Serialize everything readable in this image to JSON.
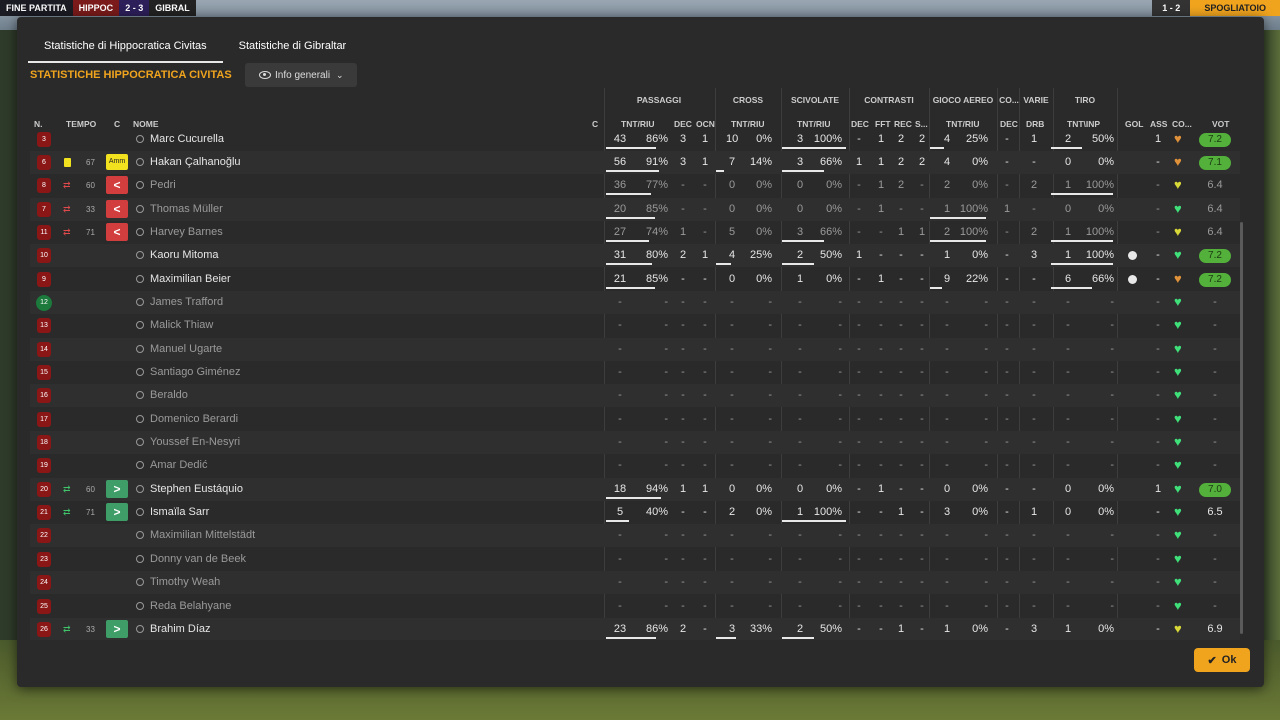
{
  "topbar": {
    "end_label": "FINE PARTITA",
    "home": "HIPPOC",
    "score": "2 - 3",
    "away": "GIBRAL",
    "time": "1 - 2",
    "dress_label": "SPOGLIATOIO"
  },
  "tabs": [
    {
      "label": "Statistiche di Hippocratica Civitas",
      "active": true
    },
    {
      "label": "Statistiche di Gibraltar",
      "active": false
    }
  ],
  "section_title": "STATISTICHE HIPPOCRATICA CIVITAS",
  "view_dropdown": {
    "label": "Info generali"
  },
  "groups": [
    "PASSAGGI",
    "CROSS",
    "SCIVOLATE",
    "CONTRASTI",
    "GIOCO AEREO",
    "CO...",
    "VARIE",
    "TIRO"
  ],
  "headers": {
    "n": "N.",
    "tempo": "TEMPO",
    "c": "C",
    "nome": "NOME",
    "c2": "C",
    "pass_tnt": "TNT/RIU",
    "pass_dec": "DEC",
    "pass_ocn": "OCN",
    "cross_tnt": "TNT/RIU",
    "sciv_tnt": "TNT/RIU",
    "con_dec": "DEC",
    "con_fft": "FFT",
    "con_rec": "REC",
    "con_s": "S...",
    "aereo_tnt": "TNT/RIU",
    "co_dec": "DEC",
    "drb": "DRB",
    "tiro_tnt": "TNT\\INP",
    "gol": "GOL",
    "ass": "ASS",
    "cond": "CO...",
    "vot": "VOT"
  },
  "players": [
    {
      "num": "3",
      "name": "Marc Cucurella",
      "active": true,
      "min": "",
      "sub": "",
      "card": "",
      "pass": [
        "43",
        "86%"
      ],
      "pass_dec": "3",
      "pass_ocn": "1",
      "cross": [
        "10",
        "0%"
      ],
      "sciv": [
        "3",
        "100%"
      ],
      "con": [
        "-",
        "1",
        "2",
        "2"
      ],
      "aereo": [
        "4",
        "25%"
      ],
      "co_dec": "-",
      "drb": "1",
      "tiro": [
        "2",
        "50%"
      ],
      "gol": "",
      "ass": "1",
      "cond": "orange",
      "vote": "7.2",
      "vote_hl": true,
      "pass_f": 0.86,
      "cross_f": 0,
      "sciv_f": 1.0,
      "aereo_f": 0.25,
      "tiro_f": 0.5
    },
    {
      "num": "6",
      "name": "Hakan Çalhanoğlu",
      "active": true,
      "min": "67",
      "sub": "",
      "card": "Amm",
      "pass": [
        "56",
        "91%"
      ],
      "pass_dec": "3",
      "pass_ocn": "1",
      "cross": [
        "7",
        "14%"
      ],
      "sciv": [
        "3",
        "66%"
      ],
      "con": [
        "1",
        "1",
        "2",
        "2"
      ],
      "aereo": [
        "4",
        "0%"
      ],
      "co_dec": "-",
      "drb": "-",
      "tiro": [
        "0",
        "0%"
      ],
      "gol": "",
      "ass": "-",
      "cond": "orange",
      "vote": "7.1",
      "vote_hl": true,
      "pass_f": 0.91,
      "cross_f": 0.14,
      "sciv_f": 0.66,
      "aereo_f": 0,
      "tiro_f": 0
    },
    {
      "num": "8",
      "name": "Pedri",
      "active": false,
      "min": "60",
      "sub": "out",
      "card": "",
      "pass": [
        "36",
        "77%"
      ],
      "pass_dec": "-",
      "pass_ocn": "-",
      "cross": [
        "0",
        "0%"
      ],
      "sciv": [
        "0",
        "0%"
      ],
      "con": [
        "-",
        "1",
        "2",
        "-"
      ],
      "aereo": [
        "2",
        "0%"
      ],
      "co_dec": "-",
      "drb": "2",
      "tiro": [
        "1",
        "100%"
      ],
      "gol": "",
      "ass": "-",
      "cond": "yellow",
      "vote": "6.4",
      "vote_hl": false,
      "pass_f": 0.77,
      "cross_f": 0,
      "sciv_f": 0,
      "aereo_f": 0,
      "tiro_f": 1.0
    },
    {
      "num": "7",
      "name": "Thomas Müller",
      "active": false,
      "min": "33",
      "sub": "out",
      "card": "",
      "pass": [
        "20",
        "85%"
      ],
      "pass_dec": "-",
      "pass_ocn": "-",
      "cross": [
        "0",
        "0%"
      ],
      "sciv": [
        "0",
        "0%"
      ],
      "con": [
        "-",
        "1",
        "-",
        "-"
      ],
      "aereo": [
        "1",
        "100%"
      ],
      "co_dec": "1",
      "drb": "-",
      "tiro": [
        "0",
        "0%"
      ],
      "gol": "",
      "ass": "-",
      "cond": "green",
      "vote": "6.4",
      "vote_hl": false,
      "pass_f": 0.85,
      "cross_f": 0,
      "sciv_f": 0,
      "aereo_f": 1.0,
      "tiro_f": 0
    },
    {
      "num": "11",
      "name": "Harvey Barnes",
      "active": false,
      "min": "71",
      "sub": "out",
      "card": "",
      "pass": [
        "27",
        "74%"
      ],
      "pass_dec": "1",
      "pass_ocn": "-",
      "cross": [
        "5",
        "0%"
      ],
      "sciv": [
        "3",
        "66%"
      ],
      "con": [
        "-",
        "-",
        "1",
        "1"
      ],
      "aereo": [
        "2",
        "100%"
      ],
      "co_dec": "-",
      "drb": "2",
      "tiro": [
        "1",
        "100%"
      ],
      "gol": "",
      "ass": "-",
      "cond": "yellow",
      "vote": "6.4",
      "vote_hl": false,
      "pass_f": 0.74,
      "cross_f": 0,
      "sciv_f": 0.66,
      "aereo_f": 1.0,
      "tiro_f": 1.0
    },
    {
      "num": "10",
      "name": "Kaoru Mitoma",
      "active": true,
      "min": "",
      "sub": "",
      "card": "",
      "pass": [
        "31",
        "80%"
      ],
      "pass_dec": "2",
      "pass_ocn": "1",
      "cross": [
        "4",
        "25%"
      ],
      "sciv": [
        "2",
        "50%"
      ],
      "con": [
        "1",
        "-",
        "-",
        "-"
      ],
      "aereo": [
        "1",
        "0%"
      ],
      "co_dec": "-",
      "drb": "3",
      "tiro": [
        "1",
        "100%"
      ],
      "gol": "ball",
      "ass": "-",
      "cond": "green",
      "vote": "7.2",
      "vote_hl": true,
      "pass_f": 0.8,
      "cross_f": 0.25,
      "sciv_f": 0.5,
      "aereo_f": 0,
      "tiro_f": 1.0
    },
    {
      "num": "9",
      "name": "Maximilian Beier",
      "active": true,
      "min": "",
      "sub": "",
      "card": "",
      "pass": [
        "21",
        "85%"
      ],
      "pass_dec": "-",
      "pass_ocn": "-",
      "cross": [
        "0",
        "0%"
      ],
      "sciv": [
        "1",
        "0%"
      ],
      "con": [
        "-",
        "1",
        "-",
        "-"
      ],
      "aereo": [
        "9",
        "22%"
      ],
      "co_dec": "-",
      "drb": "-",
      "tiro": [
        "6",
        "66%"
      ],
      "gol": "ball",
      "ass": "-",
      "cond": "orange",
      "vote": "7.2",
      "vote_hl": true,
      "pass_f": 0.85,
      "cross_f": 0,
      "sciv_f": 0,
      "aereo_f": 0.22,
      "tiro_f": 0.66
    },
    {
      "num": "12",
      "name": "James Trafford",
      "active": false,
      "gk": true,
      "empty": true
    },
    {
      "num": "13",
      "name": "Malick Thiaw",
      "active": false,
      "empty": true
    },
    {
      "num": "14",
      "name": "Manuel Ugarte",
      "active": false,
      "empty": true
    },
    {
      "num": "15",
      "name": "Santiago Giménez",
      "active": false,
      "empty": true
    },
    {
      "num": "16",
      "name": "Beraldo",
      "active": false,
      "empty": true
    },
    {
      "num": "17",
      "name": "Domenico Berardi",
      "active": false,
      "empty": true
    },
    {
      "num": "18",
      "name": "Youssef En-Nesyri",
      "active": false,
      "empty": true
    },
    {
      "num": "19",
      "name": "Amar Dedić",
      "active": false,
      "empty": true
    },
    {
      "num": "20",
      "name": "Stephen Eustáquio",
      "active": true,
      "min": "60",
      "sub": "in",
      "card": "",
      "pass": [
        "18",
        "94%"
      ],
      "pass_dec": "1",
      "pass_ocn": "1",
      "cross": [
        "0",
        "0%"
      ],
      "sciv": [
        "0",
        "0%"
      ],
      "con": [
        "-",
        "1",
        "-",
        "-"
      ],
      "aereo": [
        "0",
        "0%"
      ],
      "co_dec": "-",
      "drb": "-",
      "tiro": [
        "0",
        "0%"
      ],
      "gol": "",
      "ass": "1",
      "cond": "green",
      "vote": "7.0",
      "vote_hl": true,
      "pass_f": 0.94,
      "cross_f": 0,
      "sciv_f": 0,
      "aereo_f": 0,
      "tiro_f": 0
    },
    {
      "num": "21",
      "name": "Ismaïla Sarr",
      "active": true,
      "min": "71",
      "sub": "in",
      "card": "",
      "pass": [
        "5",
        "40%"
      ],
      "pass_dec": "-",
      "pass_ocn": "-",
      "cross": [
        "2",
        "0%"
      ],
      "sciv": [
        "1",
        "100%"
      ],
      "con": [
        "-",
        "-",
        "1",
        "-"
      ],
      "aereo": [
        "3",
        "0%"
      ],
      "co_dec": "-",
      "drb": "1",
      "tiro": [
        "0",
        "0%"
      ],
      "gol": "",
      "ass": "-",
      "cond": "green",
      "vote": "6.5",
      "vote_hl": false,
      "pass_f": 0.4,
      "cross_f": 0,
      "sciv_f": 1.0,
      "aereo_f": 0,
      "tiro_f": 0
    },
    {
      "num": "22",
      "name": "Maximilian Mittelstädt",
      "active": false,
      "empty": true
    },
    {
      "num": "23",
      "name": "Donny van de Beek",
      "active": false,
      "empty": true
    },
    {
      "num": "24",
      "name": "Timothy Weah",
      "active": false,
      "empty": true
    },
    {
      "num": "25",
      "name": "Reda Belahyane",
      "active": false,
      "empty": true
    },
    {
      "num": "26",
      "name": "Brahim Díaz",
      "active": true,
      "min": "33",
      "sub": "in",
      "card": "",
      "pass": [
        "23",
        "86%"
      ],
      "pass_dec": "2",
      "pass_ocn": "-",
      "cross": [
        "3",
        "33%"
      ],
      "sciv": [
        "2",
        "50%"
      ],
      "con": [
        "-",
        "-",
        "1",
        "-"
      ],
      "aereo": [
        "1",
        "0%"
      ],
      "co_dec": "-",
      "drb": "3",
      "tiro": [
        "1",
        "0%"
      ],
      "gol": "",
      "ass": "-",
      "cond": "yellow",
      "vote": "6.9",
      "vote_hl": false,
      "pass_f": 0.86,
      "cross_f": 0.33,
      "sciv_f": 0.5,
      "aereo_f": 0,
      "tiro_f": 0
    }
  ],
  "colors": {
    "accent": "#f0a41e",
    "shirt": "#8a1616",
    "vote_good": "#52b03b",
    "cond_green": "#3fe07a",
    "cond_yellow": "#d8d838",
    "cond_orange": "#e0923a"
  },
  "ok_label": "Ok"
}
